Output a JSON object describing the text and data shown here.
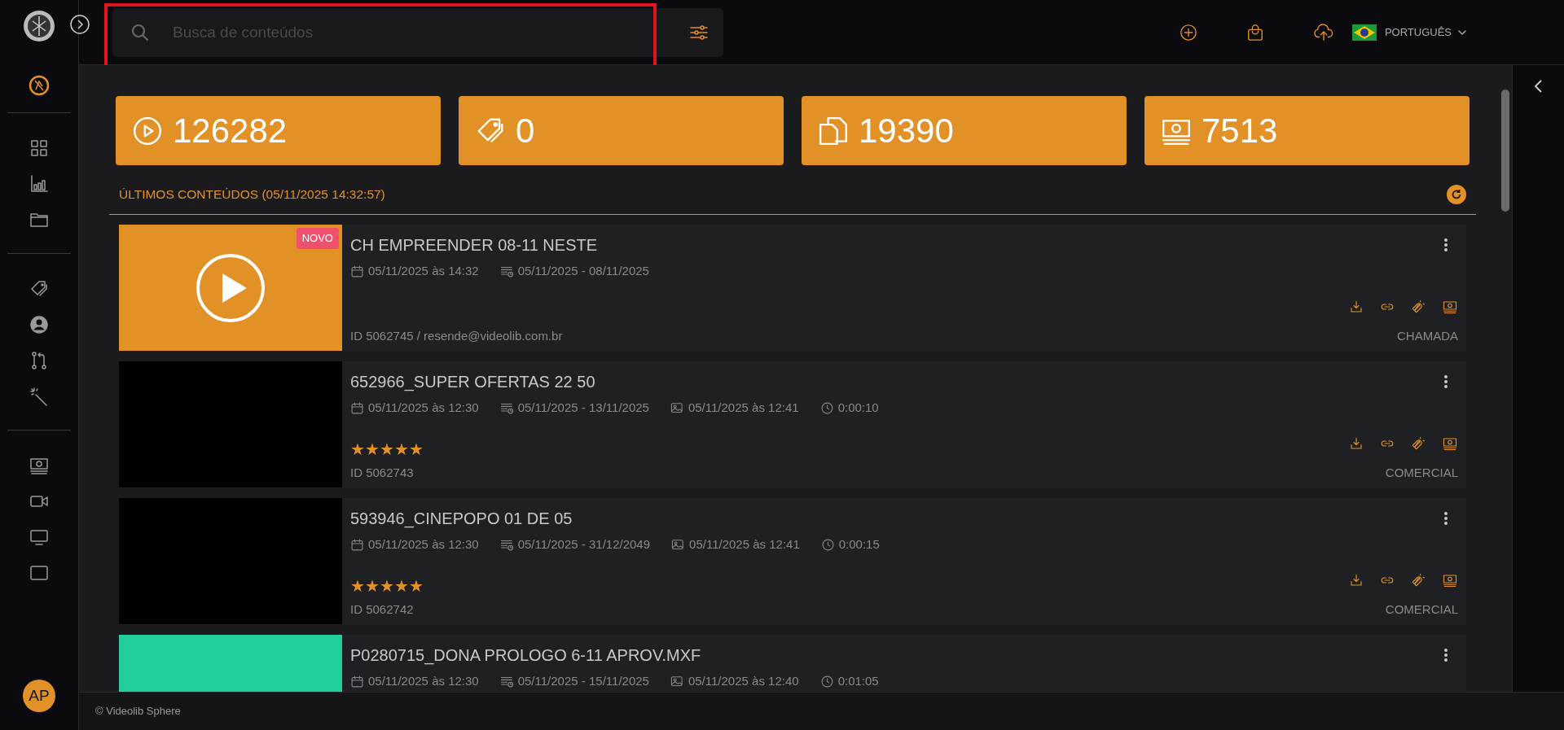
{
  "search": {
    "placeholder": "Busca de conteúdos",
    "highlighted": true
  },
  "language": {
    "label": "PORTUGUÊS"
  },
  "stats": [
    {
      "kind": "play",
      "value": "126282"
    },
    {
      "kind": "tags",
      "value": "0"
    },
    {
      "kind": "files",
      "value": "19390"
    },
    {
      "kind": "money",
      "value": "7513"
    }
  ],
  "section_title": "ÚLTIMOS CONTEÚDOS (05/11/2025 14:32:57)",
  "items": [
    {
      "title": "CH EMPREENDER 08-11 NESTE",
      "thumbnail": {
        "color": "#e29126",
        "play": true
      },
      "badge": "NOVO",
      "meta": [
        {
          "kind": "date",
          "text": "05/11/2025 às 14:32"
        },
        {
          "kind": "validity",
          "text": "05/11/2025 - 08/11/2025"
        }
      ],
      "id_line": "ID 5062745 / resende@videolib.com.br",
      "category": "CHAMADA"
    },
    {
      "title": "652966_SUPER OFERTAS 22 50",
      "thumbnail": {
        "color": "#000000",
        "play": false
      },
      "meta": [
        {
          "kind": "date",
          "text": "05/11/2025 às 12:30"
        },
        {
          "kind": "validity",
          "text": "05/11/2025 - 13/11/2025"
        },
        {
          "kind": "image",
          "text": "05/11/2025 às 12:41"
        },
        {
          "kind": "duration",
          "text": "0:00:10"
        }
      ],
      "stars": 5,
      "id_line": "ID 5062743",
      "category": "COMERCIAL"
    },
    {
      "title": "593946_CINEPOPO 01 DE 05",
      "thumbnail": {
        "color": "#000000",
        "play": false
      },
      "meta": [
        {
          "kind": "date",
          "text": "05/11/2025 às 12:30"
        },
        {
          "kind": "validity",
          "text": "05/11/2025 - 31/12/2049"
        },
        {
          "kind": "image",
          "text": "05/11/2025 às 12:41"
        },
        {
          "kind": "duration",
          "text": "0:00:15"
        }
      ],
      "stars": 5,
      "id_line": "ID 5062742",
      "category": "COMERCIAL"
    },
    {
      "title": "P0280715_DONA PROLOGO 6-11 APROV.MXF",
      "thumbnail": {
        "color": "#22cf9c",
        "play": false
      },
      "meta": [
        {
          "kind": "date",
          "text": "05/11/2025 às 12:30"
        },
        {
          "kind": "validity",
          "text": "05/11/2025 - 15/11/2025"
        },
        {
          "kind": "image",
          "text": "05/11/2025 às 12:40"
        },
        {
          "kind": "duration",
          "text": "0:01:05"
        }
      ]
    }
  ],
  "avatar": "AP",
  "footer": "© Videolib Sphere"
}
